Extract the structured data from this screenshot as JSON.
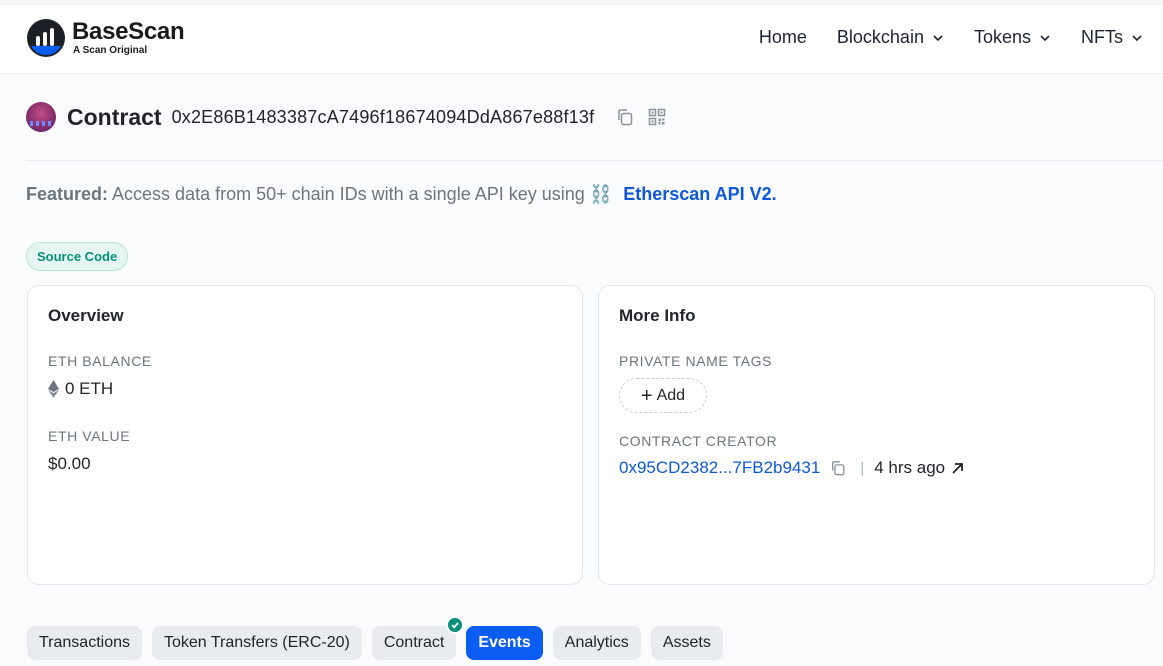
{
  "brand": {
    "name": "BaseScan",
    "tagline": "A Scan Original"
  },
  "nav": {
    "items": [
      {
        "label": "Home",
        "dropdown": false
      },
      {
        "label": "Blockchain",
        "dropdown": true
      },
      {
        "label": "Tokens",
        "dropdown": true
      },
      {
        "label": "NFTs",
        "dropdown": true
      }
    ]
  },
  "contract": {
    "title": "Contract",
    "address": "0x2E86B1483387cA7496f18674094DdA867e88f13f",
    "copy_icon": "copy-icon",
    "qr_icon": "qr-code-icon"
  },
  "featured": {
    "prefix": "Featured:",
    "text": "Access data from 50+ chain IDs with a single API key using",
    "emoji": "⛓️",
    "link": "Etherscan API V2."
  },
  "badge": {
    "label": "Source Code"
  },
  "overview": {
    "title": "Overview",
    "eth_balance_label": "ETH BALANCE",
    "eth_balance_value": "0 ETH",
    "eth_value_label": "ETH VALUE",
    "eth_value_value": "$0.00"
  },
  "more_info": {
    "title": "More Info",
    "private_tags_label": "PRIVATE NAME TAGS",
    "add_label": "Add",
    "creator_label": "CONTRACT CREATOR",
    "creator_address": "0x95CD2382...7FB2b9431",
    "separator": "|",
    "created_ago": "4 hrs ago"
  },
  "tabs": [
    {
      "label": "Transactions",
      "active": false
    },
    {
      "label": "Token Transfers (ERC-20)",
      "active": false
    },
    {
      "label": "Contract",
      "active": false,
      "verified": true
    },
    {
      "label": "Events",
      "active": true
    },
    {
      "label": "Analytics",
      "active": false
    },
    {
      "label": "Assets",
      "active": false
    }
  ],
  "colors": {
    "accent": "#0b5cf0",
    "link": "#0d58d9",
    "success": "#08907a"
  }
}
